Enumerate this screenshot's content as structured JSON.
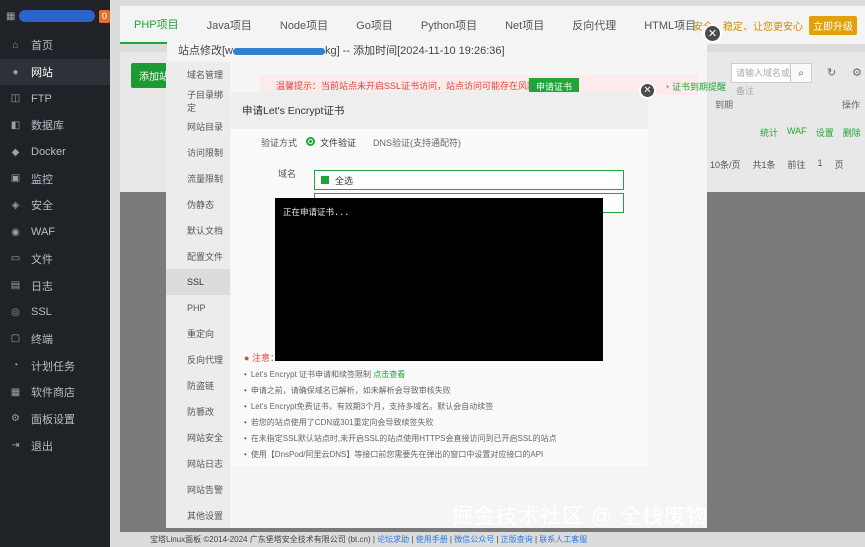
{
  "sidebar": {
    "badge": "0",
    "items": [
      {
        "label": "首页",
        "icon": "home-icon",
        "glyph": "⌂"
      },
      {
        "label": "网站",
        "icon": "globe-icon",
        "glyph": "●"
      },
      {
        "label": "FTP",
        "icon": "ftp-icon",
        "glyph": "◫"
      },
      {
        "label": "数据库",
        "icon": "database-icon",
        "glyph": "◧"
      },
      {
        "label": "Docker",
        "icon": "docker-icon",
        "glyph": "◆"
      },
      {
        "label": "监控",
        "icon": "monitor-icon",
        "glyph": "▣"
      },
      {
        "label": "安全",
        "icon": "shield-icon",
        "glyph": "◈"
      },
      {
        "label": "WAF",
        "icon": "waf-icon",
        "glyph": "◉"
      },
      {
        "label": "文件",
        "icon": "folder-icon",
        "glyph": "▭"
      },
      {
        "label": "日志",
        "icon": "log-icon",
        "glyph": "▤"
      },
      {
        "label": "SSL",
        "icon": "ssl-icon",
        "glyph": "◎"
      },
      {
        "label": "终端",
        "icon": "terminal-icon",
        "glyph": "▢"
      },
      {
        "label": "计划任务",
        "icon": "clock-icon",
        "glyph": "◔"
      },
      {
        "label": "软件商店",
        "icon": "store-icon",
        "glyph": "▦"
      },
      {
        "label": "面板设置",
        "icon": "settings-icon",
        "glyph": "⚙"
      },
      {
        "label": "退出",
        "icon": "logout-icon",
        "glyph": "⇥"
      }
    ],
    "active_index": 1
  },
  "topnav": {
    "tabs": [
      "PHP项目",
      "Java项目",
      "Node项目",
      "Go项目",
      "Python项目",
      "Net项目",
      "反向代理",
      "HTML项目"
    ],
    "active_index": 0,
    "warning": "安全、稳定、让您更安心",
    "free_btn": "立即升级"
  },
  "list": {
    "add_site": "添加站点",
    "search_placeholder": "请输入域名或备注",
    "header_expiry": "到期",
    "header_actions": "操作",
    "row_actions": [
      "统计",
      "WAF",
      "设置",
      "删除"
    ],
    "pager": [
      "10条/页",
      "共1条",
      "前往",
      "1",
      "页"
    ],
    "actions_small": "操作"
  },
  "site_modal": {
    "title_prefix": "站点修改[w",
    "title_suffix": "kg] -- 添加时间[2024-11-10 19:26:36]",
    "side_items": [
      "域名管理",
      "子目录绑定",
      "网站目录",
      "访问限制",
      "流量限制",
      "伪静态",
      "默认文档",
      "配置文件",
      "SSL",
      "PHP",
      "重定向",
      "反向代理",
      "防盗链",
      "防篡改",
      "网站安全",
      "网站日志",
      "网站告警",
      "其他设置"
    ],
    "active_side_index": 8,
    "ssl_warning": "温馨提示：当前站点未开启SSL证书访问，站点访问可能存在风险。",
    "apply_cert": "申请证书",
    "expiry_link": "证书到期提醒"
  },
  "encrypt_modal": {
    "title": "申请Let's Encrypt证书",
    "verify_label": "验证方式",
    "option_file": "文件验证",
    "option_dns": "DNS验证(支持通配符)",
    "domain_label": "域名",
    "select_all": "全选",
    "console_text": "正在申请证书...",
    "notes_head": "注意：",
    "notes": [
      {
        "text": "Let's Encrypt 证书申请和续签限制 ",
        "link": "点击查看"
      },
      {
        "text": "申请之前，请确保域名已解析，如未解析会导致审核失败"
      },
      {
        "text": "Let's Encrypt免费证书，有效期3个月，支持多域名。默认会自动续签"
      },
      {
        "text": "若您的站点使用了CDN或301重定向会导致续签失败"
      },
      {
        "text": "在未指定SSL默认站点时,未开启SSL的站点使用HTTPS会直接访问到已开启SSL的站点"
      },
      {
        "text": "使用【DnsPod/阿里云DNS】等接口前您需要先在弹出的窗口中设置对应接口的API"
      }
    ]
  },
  "footer": {
    "copyright": "宝塔Linux面板 ©2014-2024 广东堡塔安全技术有限公司 (bt.cn)",
    "links": [
      "论坛求助",
      "使用手册",
      "微信公众号",
      "正版查询",
      "联系人工客服"
    ]
  },
  "watermark": "掘金技术社区 @ 全栈废物",
  "colors": {
    "accent": "#20a53a",
    "sidebar": "#1f2328",
    "warning": "#e0463c"
  }
}
